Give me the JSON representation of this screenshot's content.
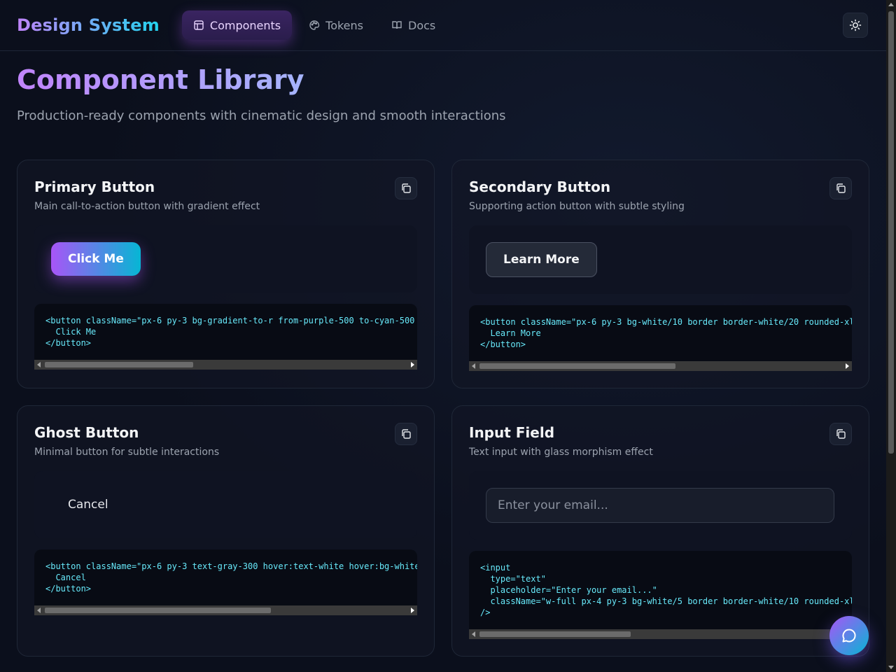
{
  "header": {
    "brand": "Design System",
    "nav": [
      {
        "label": "Components",
        "icon": "layout-icon",
        "active": true
      },
      {
        "label": "Tokens",
        "icon": "palette-icon",
        "active": false
      },
      {
        "label": "Docs",
        "icon": "book-icon",
        "active": false
      }
    ],
    "theme_icon": "sun-icon"
  },
  "hero": {
    "title": "Component Library",
    "subtitle": "Production-ready components with cinematic design and smooth interactions"
  },
  "cards": [
    {
      "title": "Primary Button",
      "description": "Main call-to-action button with gradient effect",
      "preview_label": "Click Me",
      "code": "<button className=\"px-6 py-3 bg-gradient-to-r from-purple-500 to-cyan-500\n  Click Me\n</button>"
    },
    {
      "title": "Secondary Button",
      "description": "Supporting action button with subtle styling",
      "preview_label": "Learn More",
      "code": "<button className=\"px-6 py-3 bg-white/10 border border-white/20 rounded-xl\n  Learn More\n</button>"
    },
    {
      "title": "Ghost Button",
      "description": "Minimal button for subtle interactions",
      "preview_label": "Cancel",
      "code": "<button className=\"px-6 py-3 text-gray-300 hover:text-white hover:bg-white\n  Cancel\n</button>"
    },
    {
      "title": "Input Field",
      "description": "Text input with glass morphism effect",
      "preview_placeholder": "Enter your email...",
      "code": "<input\n  type=\"text\"\n  placeholder=\"Enter your email...\"\n  className=\"w-full px-4 py-3 bg-white/5 border border-white/10 rounded-xl\n/>"
    }
  ],
  "colors": {
    "accent_purple": "#a855f7",
    "accent_cyan": "#06b6d4",
    "code_text": "#67e8f9",
    "background": "#0b0f1c"
  },
  "icons": {
    "copy": "copy-icon",
    "chat": "chat-bubble-icon"
  }
}
